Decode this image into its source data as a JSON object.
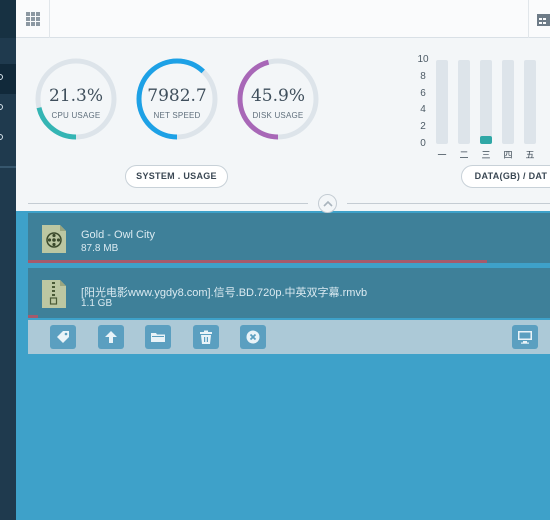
{
  "colors": {
    "sidebar": "#1f3a4e",
    "panel_bg": "#f3f6f8",
    "main_bg": "#3ea1c9",
    "list_item_bg": "#3e8099",
    "toolbar_bg": "#acc9d7",
    "button_bg": "#5b9fc0",
    "cpu_accent": "#34b5b4",
    "net_accent": "#1da1e6",
    "disk_accent": "#a867b7",
    "bar_fill": "#2fa7a6",
    "progress": "#a55a6c"
  },
  "toolbar_top": {
    "left_icon": "grid-menu-icon",
    "right_icon": "calendar-icon"
  },
  "gauges": [
    {
      "value": "21.3%",
      "label": "CPU USAGE",
      "fraction": 0.213
    },
    {
      "value": "7982.7",
      "label": "NET SPEED",
      "fraction": 0.62
    },
    {
      "value": "45.9%",
      "label": "DISK USAGE",
      "fraction": 0.459
    }
  ],
  "system_usage_label": "SYSTEM . USAGE",
  "data_label": "DATA(GB) / DAT",
  "chart_data": {
    "type": "bar",
    "categories": [
      "一",
      "二",
      "三",
      "四",
      "五"
    ],
    "values": [
      0,
      0,
      1,
      0,
      0
    ],
    "ylim": [
      0,
      10
    ],
    "yticks": [
      "10",
      "8",
      "6",
      "4",
      "2",
      "0"
    ]
  },
  "downloads": [
    {
      "name": "Gold - Owl City",
      "size": "87.8 MB",
      "icon": "music-file-icon",
      "progress": 0.88
    },
    {
      "name": "[阳光电影www.ygdy8.com].信号.BD.720p.中英双字幕.rmvb",
      "size": "1.1 GB",
      "icon": "archive-file-icon",
      "progress": 0.02
    }
  ],
  "actions": {
    "tag": "tag-icon",
    "upload": "arrow-up-icon",
    "folder": "folder-icon",
    "delete": "trash-icon",
    "cancel": "close-circle-icon",
    "monitor": "monitor-icon"
  }
}
